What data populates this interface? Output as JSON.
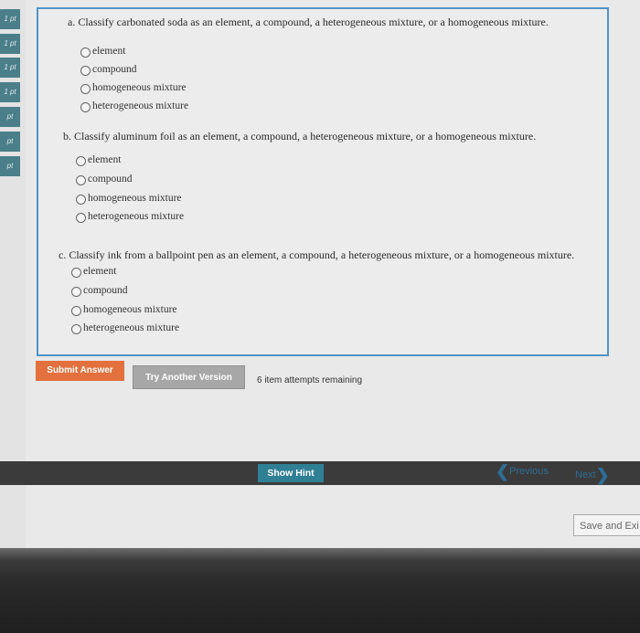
{
  "sidebar": {
    "points": [
      "1 pt",
      "1 pt",
      "1 pt",
      "1 pt",
      "pt",
      "pt",
      "pt"
    ]
  },
  "questions": [
    {
      "prompt": "a. Classify carbonated soda as an element, a compound, a heterogeneous mixture, or a homogeneous mixture.",
      "options": [
        "element",
        "compound",
        "homogeneous mixture",
        "heterogeneous mixture"
      ]
    },
    {
      "prompt": "b. Classify aluminum foil as an element, a compound, a heterogeneous mixture, or a homogeneous mixture.",
      "options": [
        "element",
        "compound",
        "homogeneous mixture",
        "heterogeneous mixture"
      ]
    },
    {
      "prompt": "c. Classify ink from a ballpoint pen as an element, a compound, a heterogeneous mixture, or a homogeneous mixture.",
      "options": [
        "element",
        "compound",
        "homogeneous mixture",
        "heterogeneous mixture"
      ]
    }
  ],
  "actions": {
    "submit_label": "Submit Answer",
    "another_label": "Try Another Version",
    "attempts": "6 item attempts remaining"
  },
  "nav": {
    "hint_label": "Show Hint",
    "previous_label": "Previous",
    "next_label": "Next",
    "save_exit_label": "Save and Exi"
  },
  "colors": {
    "accent_teal": "#4a7f8a",
    "submit": "#e2713e",
    "hint": "#2f7f95",
    "frame": "#4f93c7"
  }
}
